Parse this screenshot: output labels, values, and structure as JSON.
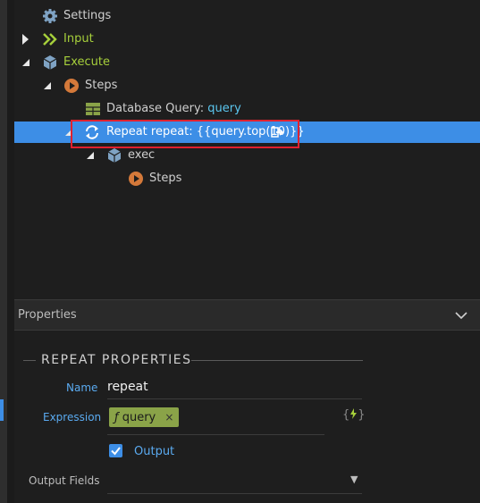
{
  "tree": {
    "settings": "Settings",
    "input": "Input",
    "execute": "Execute",
    "steps": "Steps",
    "db_query_prefix": "Database Query: ",
    "db_query_name": "query",
    "repeat": "Repeat repeat: {{query.top(10)}}",
    "exec": "exec",
    "exec_steps": "Steps"
  },
  "properties": {
    "header": "Properties",
    "section_title": "REPEAT PROPERTIES",
    "name_label": "Name",
    "name_value": "repeat",
    "expression_label": "Expression",
    "expression_chip": "query",
    "expression_chip_remove": "×",
    "expression_button": "{ }",
    "output_label": "Output",
    "output_fields_label": "Output Fields"
  },
  "colors": {
    "selection": "#3d8ee6",
    "accent_green": "#a6cf3b",
    "highlight_box": "#e0212e",
    "chip": "#8aa348"
  }
}
